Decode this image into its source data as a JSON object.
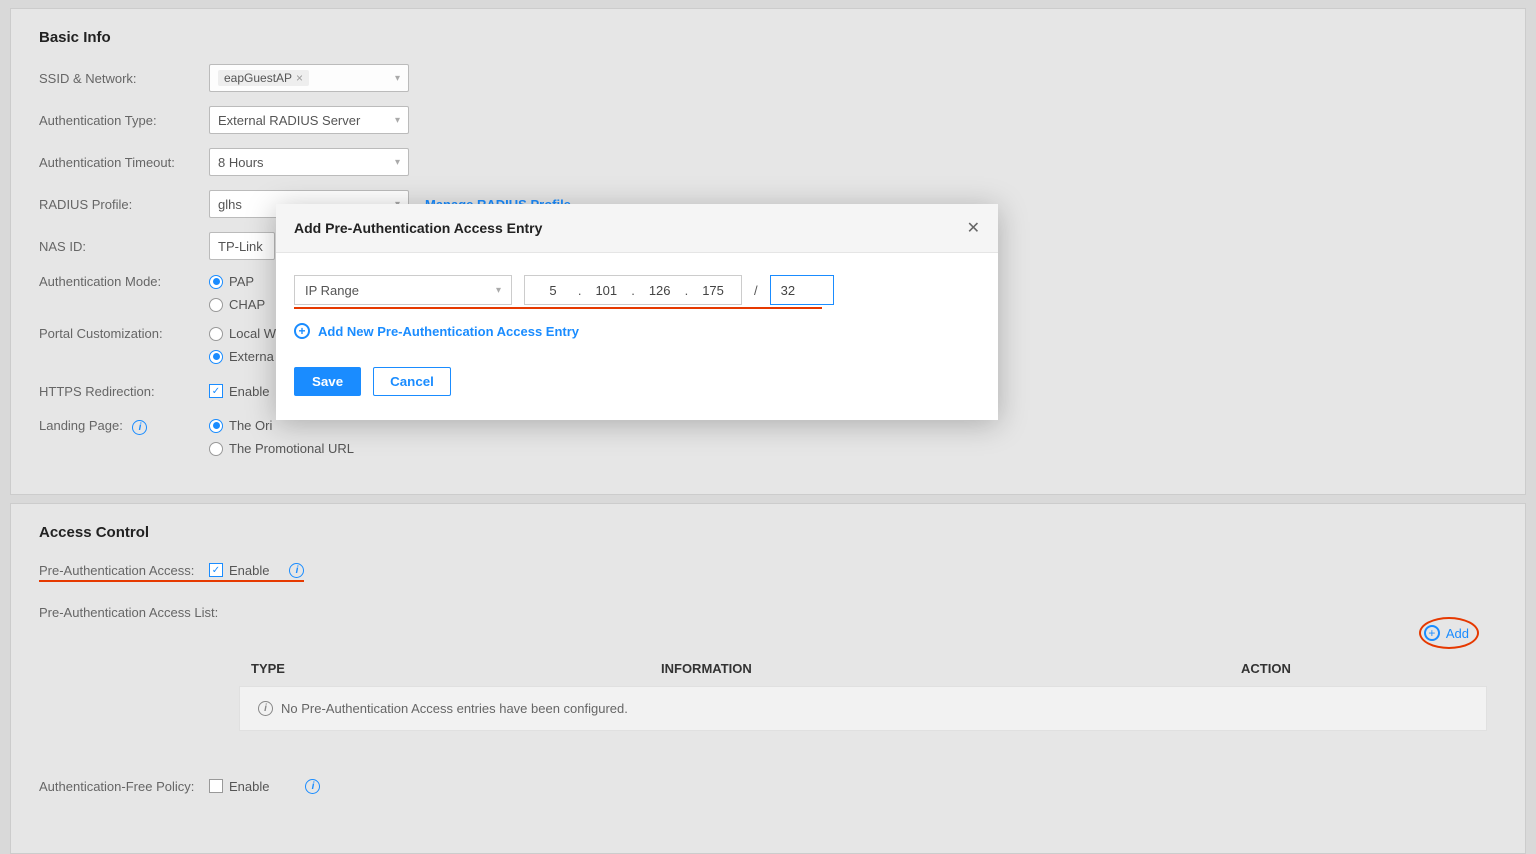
{
  "basic_info": {
    "title": "Basic Info",
    "ssid_label": "SSID & Network:",
    "ssid_value": "eapGuestAP",
    "auth_type_label": "Authentication Type:",
    "auth_type_value": "External RADIUS Server",
    "auth_timeout_label": "Authentication Timeout:",
    "auth_timeout_value": "8 Hours",
    "radius_profile_label": "RADIUS Profile:",
    "radius_profile_value": "glhs",
    "manage_radius_link": "Manage RADIUS Profile",
    "nas_id_label": "NAS ID:",
    "nas_id_value": "TP-Link",
    "auth_mode_label": "Authentication Mode:",
    "auth_mode_pap": "PAP",
    "auth_mode_chap": "CHAP",
    "portal_label": "Portal Customization:",
    "portal_local": "Local W",
    "portal_external": "Externa",
    "https_label": "HTTPS Redirection:",
    "https_enable": "Enable",
    "landing_label": "Landing Page:",
    "landing_original": "The Ori",
    "landing_promo": "The Promotional URL"
  },
  "modal": {
    "title": "Add Pre-Authentication Access Entry",
    "entry_type": "IP Range",
    "ip": {
      "o1": "5",
      "o2": "101",
      "o3": "126",
      "o4": "175"
    },
    "mask": "32",
    "add_new": "Add New Pre-Authentication Access Entry",
    "save": "Save",
    "cancel": "Cancel"
  },
  "access_control": {
    "title": "Access Control",
    "preauth_label": "Pre-Authentication Access:",
    "enable_text": "Enable",
    "list_label": "Pre-Authentication Access List:",
    "add_text": "Add",
    "columns": {
      "type": "TYPE",
      "info": "INFORMATION",
      "action": "ACTION"
    },
    "empty_msg": "No Pre-Authentication Access entries have been configured.",
    "auth_free_label": "Authentication-Free Policy:",
    "auth_free_enable": "Enable"
  }
}
